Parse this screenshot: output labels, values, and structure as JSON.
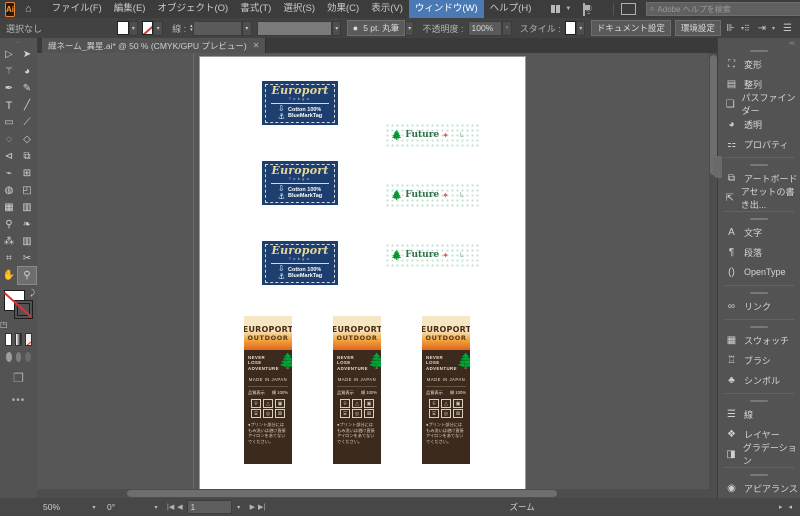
{
  "app": {
    "logo_text": "Ai",
    "home_icon": "home-icon",
    "search_placeholder": "Adobe ヘルプを検索",
    "search_icon": "search-icon",
    "account_icon": "account-icon",
    "workspace_icon": "workspace-switcher-icon",
    "arrange_icon": "arrange-documents-icon",
    "minimize": "—",
    "restore": "❐",
    "close": "✕"
  },
  "menu": {
    "items": [
      "ファイル(F)",
      "編集(E)",
      "オブジェクト(O)",
      "書式(T)",
      "選択(S)",
      "効果(C)",
      "表示(V)",
      "ウィンドウ(W)",
      "ヘルプ(H)"
    ],
    "active_index": 7
  },
  "control_bar": {
    "selection_label": "選択なし",
    "fill_label": "fill-swatch",
    "stroke_label": "stroke-swatch-none",
    "stroke_weight_label": "線 :",
    "stroke_weight_value": "",
    "variable_width_value": "",
    "brush_definition": "5 pt. 丸筆",
    "opacity_label": "不透明度 :",
    "opacity_value": "100%",
    "style_label": "スタイル :",
    "document_setup": "ドキュメント設定",
    "preferences": "環境設定",
    "align_icon": "align-icon",
    "transform_icon": "transform-icon",
    "distribute_icon": "distribute-spacing-icon",
    "more_icon": "more-options-icon"
  },
  "document_tab": {
    "title": "織ネーム_異星.ai* @ 50 % (CMYK/GPU プレビュー)",
    "close_icon": "✕"
  },
  "toolbar": {
    "tools": [
      {
        "name": "selection-tool",
        "glyph": "▶"
      },
      {
        "name": "direct-selection-tool",
        "glyph": "◤"
      },
      {
        "name": "magic-wand-tool",
        "glyph": "✶"
      },
      {
        "name": "lasso-tool",
        "glyph": "◉"
      },
      {
        "name": "pen-tool",
        "glyph": "✒"
      },
      {
        "name": "curvature-tool",
        "glyph": "✐"
      },
      {
        "name": "type-tool",
        "glyph": "T"
      },
      {
        "name": "line-segment-tool",
        "glyph": "╱"
      },
      {
        "name": "rectangle-tool",
        "glyph": "▭"
      },
      {
        "name": "paintbrush-tool",
        "glyph": "🖌"
      },
      {
        "name": "shaper-tool",
        "glyph": "◌"
      },
      {
        "name": "eraser-tool",
        "glyph": "◇"
      },
      {
        "name": "rotate-tool",
        "glyph": "↻"
      },
      {
        "name": "scale-tool",
        "glyph": "⬚"
      },
      {
        "name": "width-tool",
        "glyph": "⌁"
      },
      {
        "name": "free-transform-tool",
        "glyph": "⊞"
      },
      {
        "name": "shape-builder-tool",
        "glyph": "◍"
      },
      {
        "name": "perspective-grid-tool",
        "glyph": "▤"
      },
      {
        "name": "mesh-tool",
        "glyph": "▦"
      },
      {
        "name": "gradient-tool",
        "glyph": "▥"
      },
      {
        "name": "eyedropper-tool",
        "glyph": "⚲"
      },
      {
        "name": "blend-tool",
        "glyph": "❧"
      },
      {
        "name": "symbol-sprayer-tool",
        "glyph": "⁂"
      },
      {
        "name": "column-graph-tool",
        "glyph": "▮"
      },
      {
        "name": "artboard-tool",
        "glyph": "⌗"
      },
      {
        "name": "slice-tool",
        "glyph": "✂"
      },
      {
        "name": "hand-tool",
        "glyph": "✋"
      },
      {
        "name": "zoom-tool",
        "glyph": "🔍"
      }
    ],
    "selected_tool": "zoom-tool",
    "fill_swatch": "#ffffff",
    "stroke_swatch": "none",
    "swap_icon": "swap-fill-stroke-icon",
    "default_icon": "default-fill-stroke-icon",
    "color_mode_icons": [
      "color-swatch",
      "gradient-swatch",
      "none-swatch"
    ],
    "draw_mode_icons": [
      "draw-normal",
      "draw-behind",
      "draw-inside"
    ],
    "screen_mode_icon": "change-screen-mode-icon",
    "more_tools_icon": "edit-toolbar-icon"
  },
  "panels": {
    "groups": [
      {
        "items": [
          {
            "label": "変形",
            "icon": "transform-panel-icon"
          },
          {
            "label": "整列",
            "icon": "align-panel-icon"
          },
          {
            "label": "パスファインダー",
            "icon": "pathfinder-panel-icon"
          },
          {
            "label": "透明",
            "icon": "transparency-panel-icon"
          },
          {
            "label": "プロパティ",
            "icon": "properties-panel-icon"
          }
        ]
      },
      {
        "items": [
          {
            "label": "アートボード",
            "icon": "artboards-panel-icon"
          },
          {
            "label": "アセットの書き出...",
            "icon": "asset-export-panel-icon"
          }
        ]
      },
      {
        "items": [
          {
            "label": "文字",
            "icon": "character-panel-icon"
          },
          {
            "label": "段落",
            "icon": "paragraph-panel-icon"
          },
          {
            "label": "OpenType",
            "icon": "opentype-panel-icon"
          }
        ]
      },
      {
        "items": [
          {
            "label": "リンク",
            "icon": "links-panel-icon"
          }
        ]
      },
      {
        "items": [
          {
            "label": "スウォッチ",
            "icon": "swatches-panel-icon"
          },
          {
            "label": "ブラシ",
            "icon": "brushes-panel-icon"
          },
          {
            "label": "シンボル",
            "icon": "symbols-panel-icon"
          }
        ]
      },
      {
        "items": [
          {
            "label": "線",
            "icon": "stroke-panel-icon"
          },
          {
            "label": "レイヤー",
            "icon": "layers-panel-icon"
          },
          {
            "label": "グラデーション",
            "icon": "gradient-panel-icon"
          }
        ]
      },
      {
        "items": [
          {
            "label": "アピアランス",
            "icon": "appearance-panel-icon"
          }
        ]
      }
    ]
  },
  "status_bar": {
    "zoom_value": "50%",
    "rotation_value": "0°",
    "artboard_number": "1",
    "tool_label": "ズーム",
    "first_icon": "first-artboard-icon",
    "prev_icon": "previous-artboard-icon",
    "next_icon": "next-artboard-icon",
    "last_icon": "last-artboard-icon"
  },
  "artwork": {
    "woven_labels": [
      {
        "brand": "Europort",
        "brand_sub": "Tokyo",
        "line1": "Cotton 100%",
        "line2": "BlueMarkTag",
        "icon1": "arrow-down-icon",
        "icon2": "anchor-icon",
        "bg": "#1d3e6e"
      },
      {
        "brand": "Europort",
        "brand_sub": "Tokyo",
        "line1": "Cotton 100%",
        "line2": "BlueMarkTag",
        "icon1": "arrow-down-icon",
        "icon2": "anchor-icon",
        "bg": "#1d3e6e"
      },
      {
        "brand": "Europort",
        "brand_sub": "Tokyo",
        "line1": "Cotton 100%",
        "line2": "BlueMarkTag",
        "icon1": "arrow-down-icon",
        "icon2": "anchor-icon",
        "bg": "#1d3e6e"
      }
    ],
    "green_labels": [
      {
        "word": "Future",
        "tree_icon": "tree-icon",
        "dot": "✦",
        "tail": "L"
      },
      {
        "word": "Future",
        "tree_icon": "tree-icon",
        "dot": "✦",
        "tail": "L"
      },
      {
        "word": "Future",
        "tree_icon": "tree-icon",
        "dot": "✦",
        "tail": "L"
      }
    ],
    "hang_tags": [
      {
        "title": "EUROPORT",
        "subtitle": "OUTDOOR",
        "slogan_l1": "NEVER",
        "slogan_l2": "LOSE",
        "slogan_l3": "ADVENTURE",
        "origin": "MADE IN JAPAN",
        "quality_label": "品質表示",
        "quality_value": "綿 100%",
        "care_icons": [
          "wash-icon",
          "bleach-icon",
          "dry-icon",
          "iron-icon",
          "dryclean-icon",
          "no-tumble-icon"
        ],
        "note": "●プリント部分にはもみ洗いは避け直接アイロンをあてないでください。"
      },
      {
        "title": "EUROPORT",
        "subtitle": "OUTDOOR",
        "slogan_l1": "NEVER",
        "slogan_l2": "LOSE",
        "slogan_l3": "ADVENTURE",
        "origin": "MADE IN JAPAN",
        "quality_label": "品質表示",
        "quality_value": "綿 100%",
        "care_icons": [
          "wash-icon",
          "bleach-icon",
          "dry-icon",
          "iron-icon",
          "dryclean-icon",
          "no-tumble-icon"
        ],
        "note": "●プリント部分にはもみ洗いは避け直接アイロンをあてないでください。"
      },
      {
        "title": "EUROPORT",
        "subtitle": "OUTDOOR",
        "slogan_l1": "NEVER",
        "slogan_l2": "LOSE",
        "slogan_l3": "ADVENTURE",
        "origin": "MADE IN JAPAN",
        "quality_label": "品質表示",
        "quality_value": "綿 100%",
        "care_icons": [
          "wash-icon",
          "bleach-icon",
          "dry-icon",
          "iron-icon",
          "dryclean-icon",
          "no-tumble-icon"
        ],
        "note": "●プリント部分にはもみ洗いは避け直接アイロンをあてないでください。"
      }
    ]
  }
}
